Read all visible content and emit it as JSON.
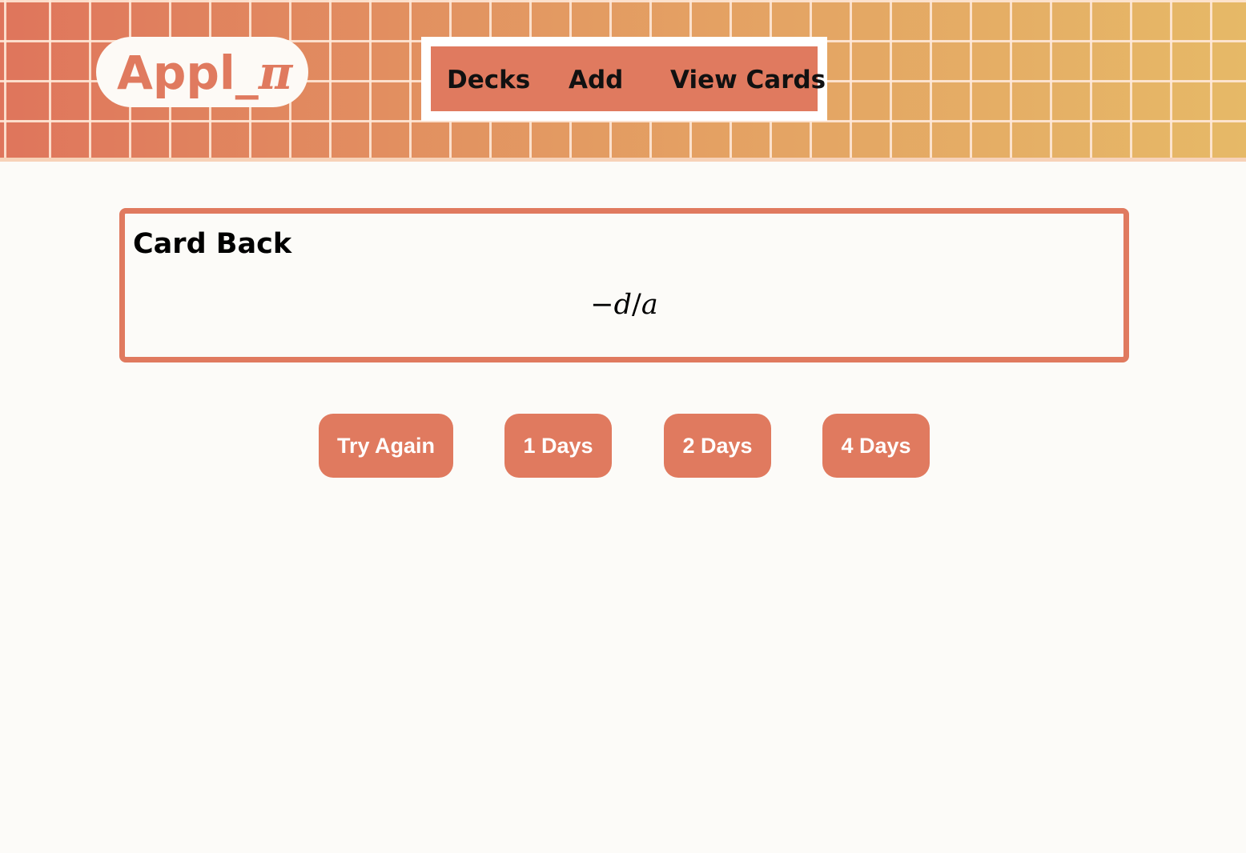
{
  "app": {
    "logo_text": "Appl_",
    "logo_pi": "π"
  },
  "nav": {
    "items": [
      {
        "label": "Decks"
      },
      {
        "label": "Add"
      },
      {
        "label": "View Cards"
      }
    ]
  },
  "card": {
    "title": "Card Back",
    "answer_minus": "−",
    "answer_d": "d",
    "answer_slash": "/",
    "answer_a": "a"
  },
  "review": {
    "buttons": [
      {
        "label": "Try Again"
      },
      {
        "label": "1 Days"
      },
      {
        "label": "2 Days"
      },
      {
        "label": "4 Days"
      }
    ]
  },
  "colors": {
    "accent": "#e07a5f",
    "background": "#fcfbf8",
    "header_gradient_end": "#e6b967"
  }
}
